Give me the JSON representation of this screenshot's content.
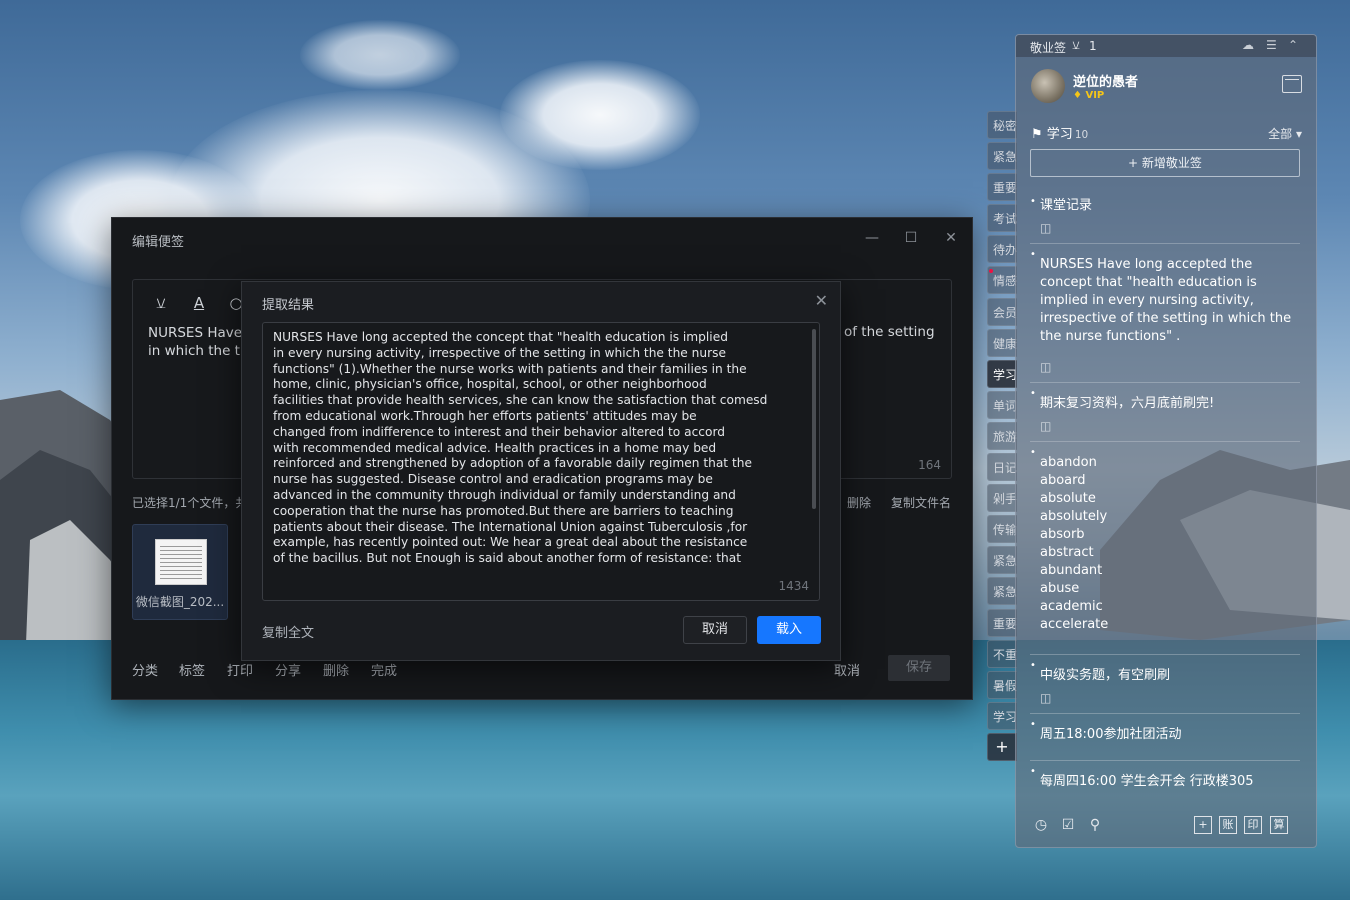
{
  "editor": {
    "title": "编辑便签",
    "note_text_line1": "NURSES Have l",
    "note_text_line2": "in which the th",
    "note_text_right": "of the setting",
    "char_count": "164",
    "selection_info": "已选择1/1个文件，共",
    "delete_label": "删除",
    "copy_filename_label": "复制文件名",
    "thumbnail_label": "微信截图_202...",
    "bottom_actions": [
      "分类",
      "标签",
      "打印",
      "分享",
      "删除",
      "完成"
    ],
    "cancel_label": "取消",
    "save_label": "保存"
  },
  "dialog": {
    "title": "提取结果",
    "lines": [
      "NURSES Have long accepted the concept that \"health education is implied",
      "in every nursing activity, irrespective of the setting in which the the nurse",
      "functions\" (1).Whether the nurse works with patients and their families in the",
      "home, clinic, physician's office, hospital, school, or other neighborhood",
      "facilities that provide health services, she can know the satisfaction that comesd",
      "from educational work.Through her efforts patients' attitudes may be",
      "changed from indifference to interest and their behavior altered to accord",
      "with recommended medical advice. Health practices in a home may bed",
      "reinforced and strengthened by adoption of a favorable daily regimen that the",
      "nurse has suggested. Disease control and eradication programs may be",
      "advanced in the community through individual or family understanding and",
      "cooperation that the nurse has promoted.But there are barriers to teaching",
      "patients about their disease. The International Union against Tuberculosis ,for",
      "example, has recently pointed out: We hear a great deal about the resistance",
      "of the bacillus. But not Enough is said about another form of resistance: that"
    ],
    "char_count": "1434",
    "copy_all_label": "复制全文",
    "cancel_label": "取消",
    "load_label": "载入"
  },
  "side_tabs": [
    "秘密",
    "紧急",
    "重要",
    "考试",
    "待办",
    "情感",
    "会员",
    "健康",
    "学习",
    "单词",
    "旅游",
    "日记",
    "剁手",
    "传输",
    "紧急",
    "紧急",
    "重要",
    "不重",
    "暑假",
    "学习"
  ],
  "active_tab_index": 8,
  "panel": {
    "app_name": "敬业签",
    "notification_count": "1",
    "username": "逆位的愚者",
    "vip_label": "VIP",
    "category_name": "学习",
    "category_count": "10",
    "filter_label": "全部",
    "new_note_label": "新增敬业签",
    "notes": [
      {
        "text": "课堂记录"
      },
      {
        "text": "NURSES Have long accepted the concept that \"health education is implied in every nursing activity, irrespective of the setting in which the the nurse functions\" ."
      },
      {
        "text": "期末复习资料，六月底前刷完!"
      },
      {
        "words": [
          "abandon",
          "aboard",
          "absolute",
          "absolutely",
          "absorb",
          "abstract",
          "abundant",
          "abuse",
          "academic",
          "accelerate"
        ]
      },
      {
        "text": "中级实务题，有空刷刷"
      },
      {
        "text": "周五18:00参加社团活动"
      },
      {
        "text": "每周四16:00 学生会开会 行政楼305"
      }
    ],
    "bottom_icons": [
      "clock-icon",
      "checklist-icon",
      "search-icon"
    ],
    "bottom_boxes": [
      "+",
      "账",
      "印",
      "算"
    ]
  },
  "colors": {
    "accent": "#1677ff",
    "vip": "#f5c518"
  }
}
